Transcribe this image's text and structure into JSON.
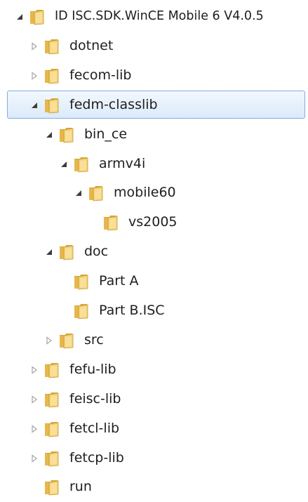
{
  "tree": {
    "items": [
      {
        "label": "ID ISC.SDK.WinCE Mobile 6 V4.0.5",
        "expander": "expanded",
        "depth": 0
      },
      {
        "label": "dotnet",
        "expander": "collapsed",
        "depth": 1
      },
      {
        "label": "fecom-lib",
        "expander": "collapsed",
        "depth": 1
      },
      {
        "label": "fedm-classlib",
        "expander": "expanded",
        "depth": 1,
        "selected": true
      },
      {
        "label": "bin_ce",
        "expander": "expanded",
        "depth": 2
      },
      {
        "label": "armv4i",
        "expander": "expanded",
        "depth": 3
      },
      {
        "label": "mobile60",
        "expander": "expanded",
        "depth": 4
      },
      {
        "label": "vs2005",
        "expander": "none",
        "depth": 5
      },
      {
        "label": "doc",
        "expander": "expanded",
        "depth": 2
      },
      {
        "label": "Part A",
        "expander": "none",
        "depth": 3
      },
      {
        "label": "Part B.ISC",
        "expander": "none",
        "depth": 3
      },
      {
        "label": "src",
        "expander": "collapsed",
        "depth": 2
      },
      {
        "label": "fefu-lib",
        "expander": "collapsed",
        "depth": 1
      },
      {
        "label": "feisc-lib",
        "expander": "collapsed",
        "depth": 1
      },
      {
        "label": "fetcl-lib",
        "expander": "collapsed",
        "depth": 1
      },
      {
        "label": "fetcp-lib",
        "expander": "collapsed",
        "depth": 1
      },
      {
        "label": "run",
        "expander": "none",
        "depth": 1
      }
    ]
  },
  "colors": {
    "selection_fill": "#dbeafb",
    "selection_border": "#84acdd",
    "folder_body": "#f3d27a",
    "folder_dark": "#d9a83a",
    "expanded_arrow": "#3c3c3c",
    "collapsed_arrow": "#a6a6a6"
  },
  "icons": {
    "folder": "folder-icon",
    "expanded": "expanded-arrow-icon",
    "collapsed": "collapsed-arrow-icon"
  }
}
